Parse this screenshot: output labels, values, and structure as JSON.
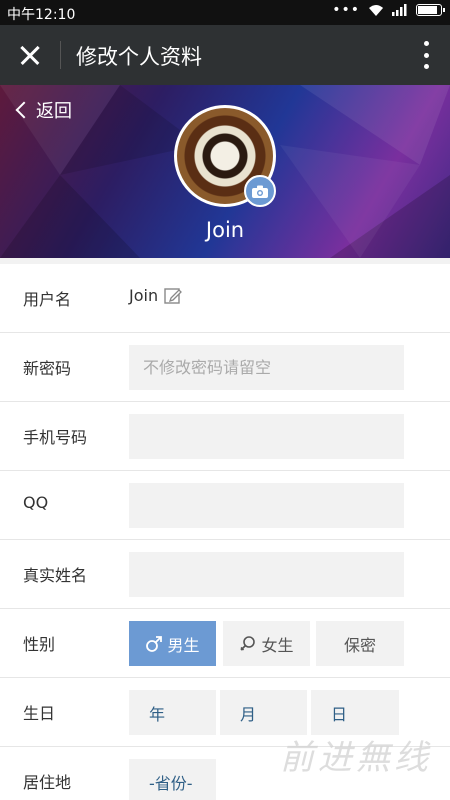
{
  "status_bar": {
    "time": "中午12:10",
    "dots": "•••",
    "battery_level": 0.9
  },
  "title_bar": {
    "title": "修改个人资料"
  },
  "hero": {
    "back_label": "返回",
    "name": "Join"
  },
  "form": {
    "username": {
      "label": "用户名",
      "value": "Join"
    },
    "password": {
      "label": "新密码",
      "placeholder": "不修改密码请留空"
    },
    "phone": {
      "label": "手机号码",
      "placeholder": ""
    },
    "qq": {
      "label": "QQ",
      "placeholder": ""
    },
    "realname": {
      "label": "真实姓名",
      "placeholder": ""
    },
    "gender": {
      "label": "性别",
      "options": {
        "male": "男生",
        "female": "女生",
        "secret": "保密"
      },
      "selected": "male"
    },
    "birthday": {
      "label": "生日",
      "year": "年",
      "month": "月",
      "day": "日"
    },
    "residence": {
      "label": "居住地",
      "province": "-省份-"
    }
  },
  "watermark": "前进無线",
  "colors": {
    "accent": "#6c9ad3",
    "title_bar": "#2e3133",
    "status_bar": "#111111"
  }
}
